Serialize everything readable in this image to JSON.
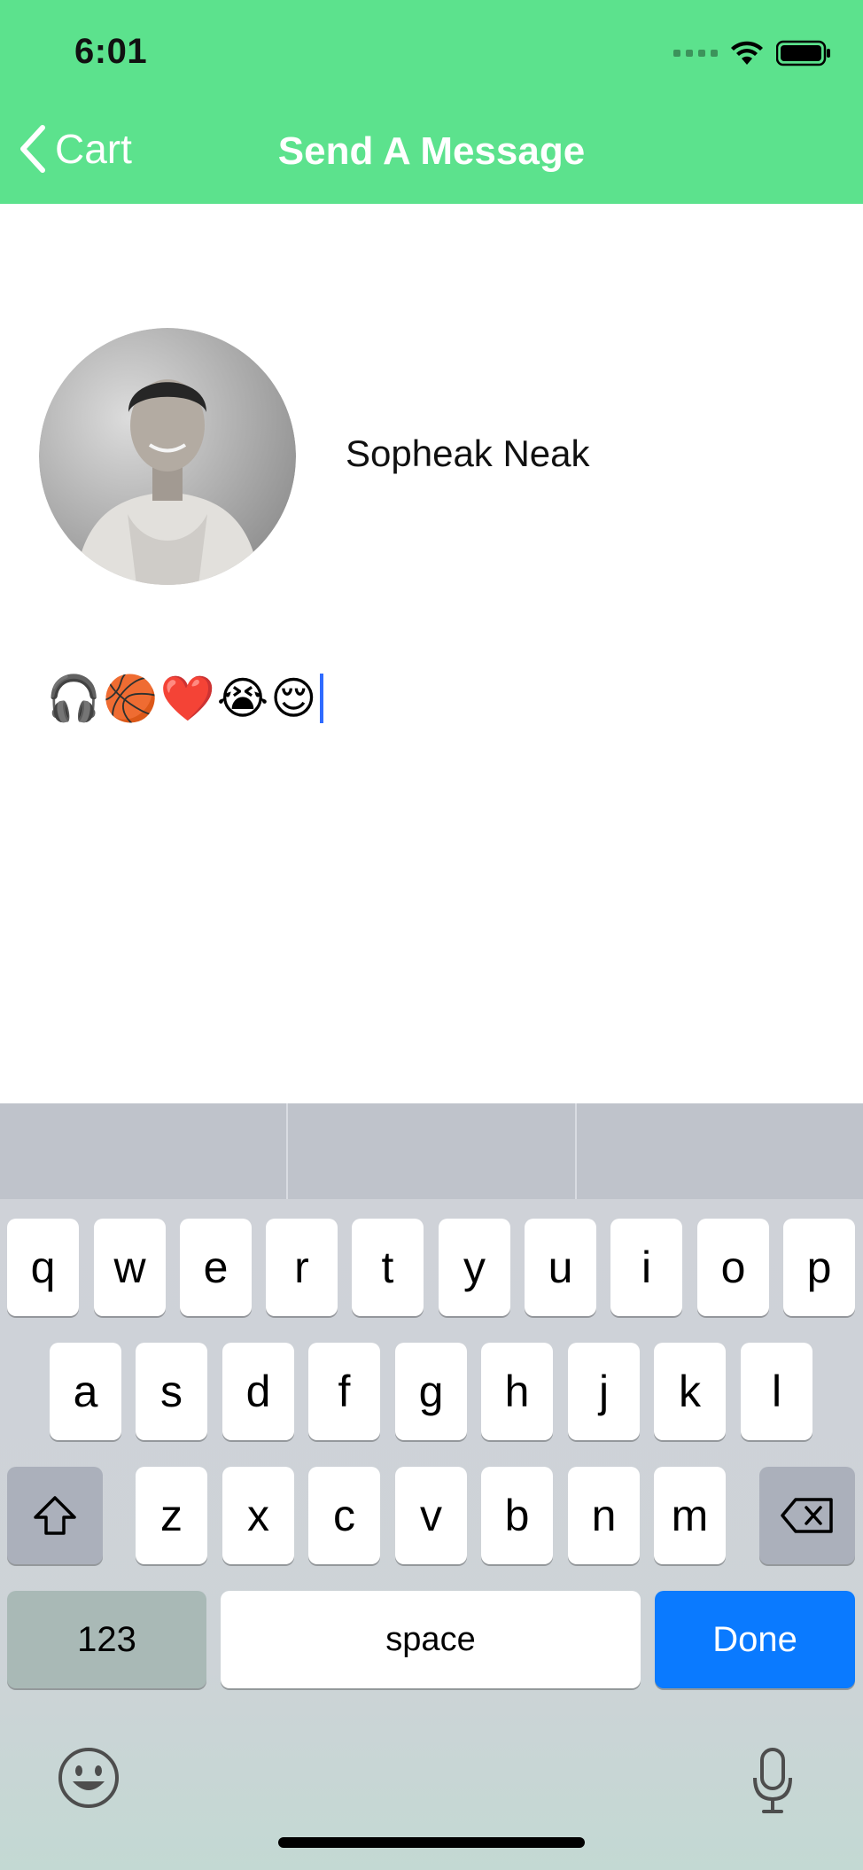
{
  "status_bar": {
    "time": "6:01"
  },
  "nav": {
    "back_label": "Cart",
    "title": "Send A Message"
  },
  "profile": {
    "name": "Sopheak Neak"
  },
  "message": {
    "text": "🎧🏀❤️😭😌"
  },
  "keyboard": {
    "row1": [
      "q",
      "w",
      "e",
      "r",
      "t",
      "y",
      "u",
      "i",
      "o",
      "p"
    ],
    "row2": [
      "a",
      "s",
      "d",
      "f",
      "g",
      "h",
      "j",
      "k",
      "l"
    ],
    "row3": [
      "z",
      "x",
      "c",
      "v",
      "b",
      "n",
      "m"
    ],
    "numbers_label": "123",
    "space_label": "space",
    "done_label": "Done"
  },
  "colors": {
    "header": "#5ce28d",
    "done_key": "#0a7aff",
    "caret": "#2f6bff"
  }
}
